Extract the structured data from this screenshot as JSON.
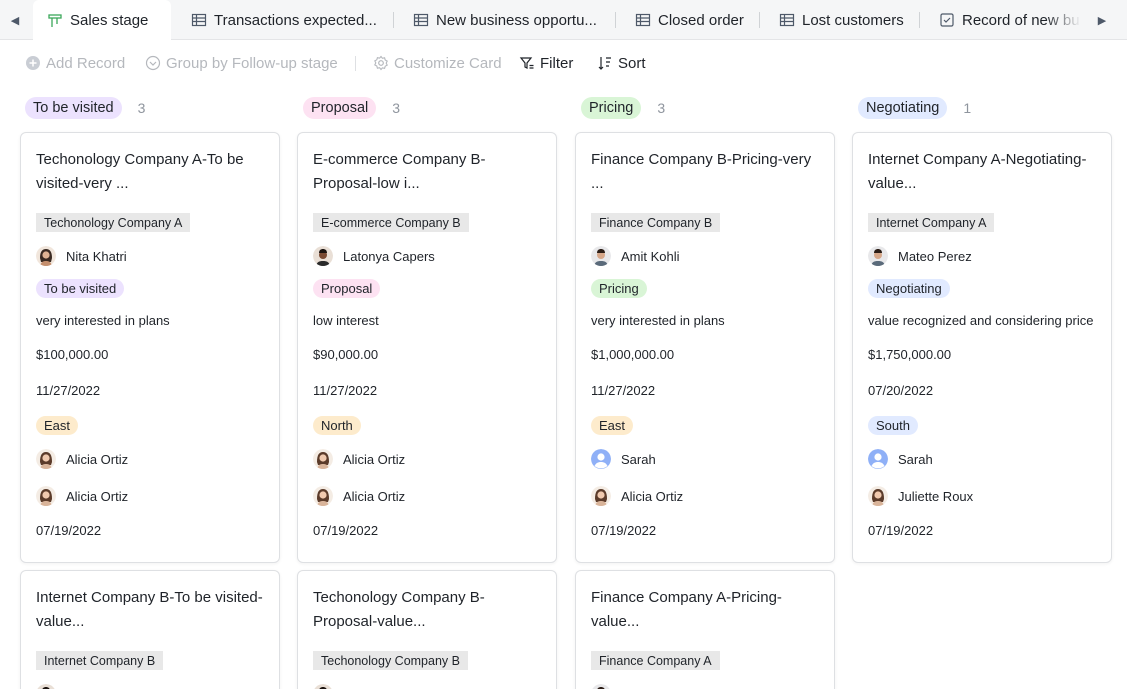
{
  "tabs": [
    {
      "label": "Sales stage",
      "icon": "kanban-icon",
      "active": true
    },
    {
      "label": "Transactions expected...",
      "icon": "table-icon"
    },
    {
      "label": "New business opportu...",
      "icon": "table-icon"
    },
    {
      "label": "Closed order",
      "icon": "table-icon"
    },
    {
      "label": "Lost customers",
      "icon": "table-icon"
    },
    {
      "label": "Record of new bu",
      "icon": "form-icon"
    }
  ],
  "toolbar": {
    "add_record": "Add Record",
    "group_by": "Group by Follow-up stage",
    "customize_card": "Customize Card",
    "filter": "Filter",
    "sort": "Sort"
  },
  "colors": {
    "to_be_visited": "#ece2fe",
    "proposal": "#fde2f2",
    "pricing": "#d9f5d6",
    "negotiating": "#e1eaff",
    "region_east_north": "#fdebcc",
    "region_south": "#e1eaff",
    "disabled_text": "#b5b8bd"
  },
  "columns": [
    {
      "stage": "To be visited",
      "count": "3",
      "cards": [
        {
          "title": "Techonology Company A-To be visited-very ...",
          "company": "Techonology Company A",
          "contact": "Nita Khatri",
          "stage": "To be visited",
          "note": "very interested in plans",
          "amount": "$100,000.00",
          "date": "11/27/2022",
          "region": "East",
          "owner": "Alicia Ortiz",
          "person2": "Alicia Ortiz",
          "created": "07/19/2022"
        },
        {
          "title": "Internet Company B-To be visited-value...",
          "company": "Internet Company B"
        }
      ]
    },
    {
      "stage": "Proposal",
      "count": "3",
      "cards": [
        {
          "title": "E-commerce Company B-Proposal-low i...",
          "company": "E-commerce Company B",
          "contact": "Latonya Capers",
          "stage": "Proposal",
          "note": "low interest",
          "amount": "$90,000.00",
          "date": "11/27/2022",
          "region": "North",
          "owner": "Alicia Ortiz",
          "person2": "Alicia Ortiz",
          "created": "07/19/2022"
        },
        {
          "title": "Techonology Company B-Proposal-value...",
          "company": "Techonology Company B"
        }
      ]
    },
    {
      "stage": "Pricing",
      "count": "3",
      "cards": [
        {
          "title": "Finance Company B-Pricing-very ...",
          "company": "Finance Company B",
          "contact": "Amit Kohli",
          "stage": "Pricing",
          "note": "very interested in plans",
          "amount": "$1,000,000.00",
          "date": "11/27/2022",
          "region": "East",
          "owner": "Sarah",
          "person2": "Alicia Ortiz",
          "created": "07/19/2022"
        },
        {
          "title": "Finance Company A-Pricing-value...",
          "company": "Finance Company A"
        }
      ]
    },
    {
      "stage": "Negotiating",
      "count": "1",
      "cards": [
        {
          "title": "Internet Company A-Negotiating-value...",
          "company": "Internet Company A",
          "contact": "Mateo Perez",
          "stage": "Negotiating",
          "note": "value recognized and considering price",
          "amount": "$1,750,000.00",
          "date": "07/20/2022",
          "region": "South",
          "owner": "Sarah",
          "person2": "Juliette Roux",
          "created": "07/19/2022"
        }
      ]
    }
  ]
}
